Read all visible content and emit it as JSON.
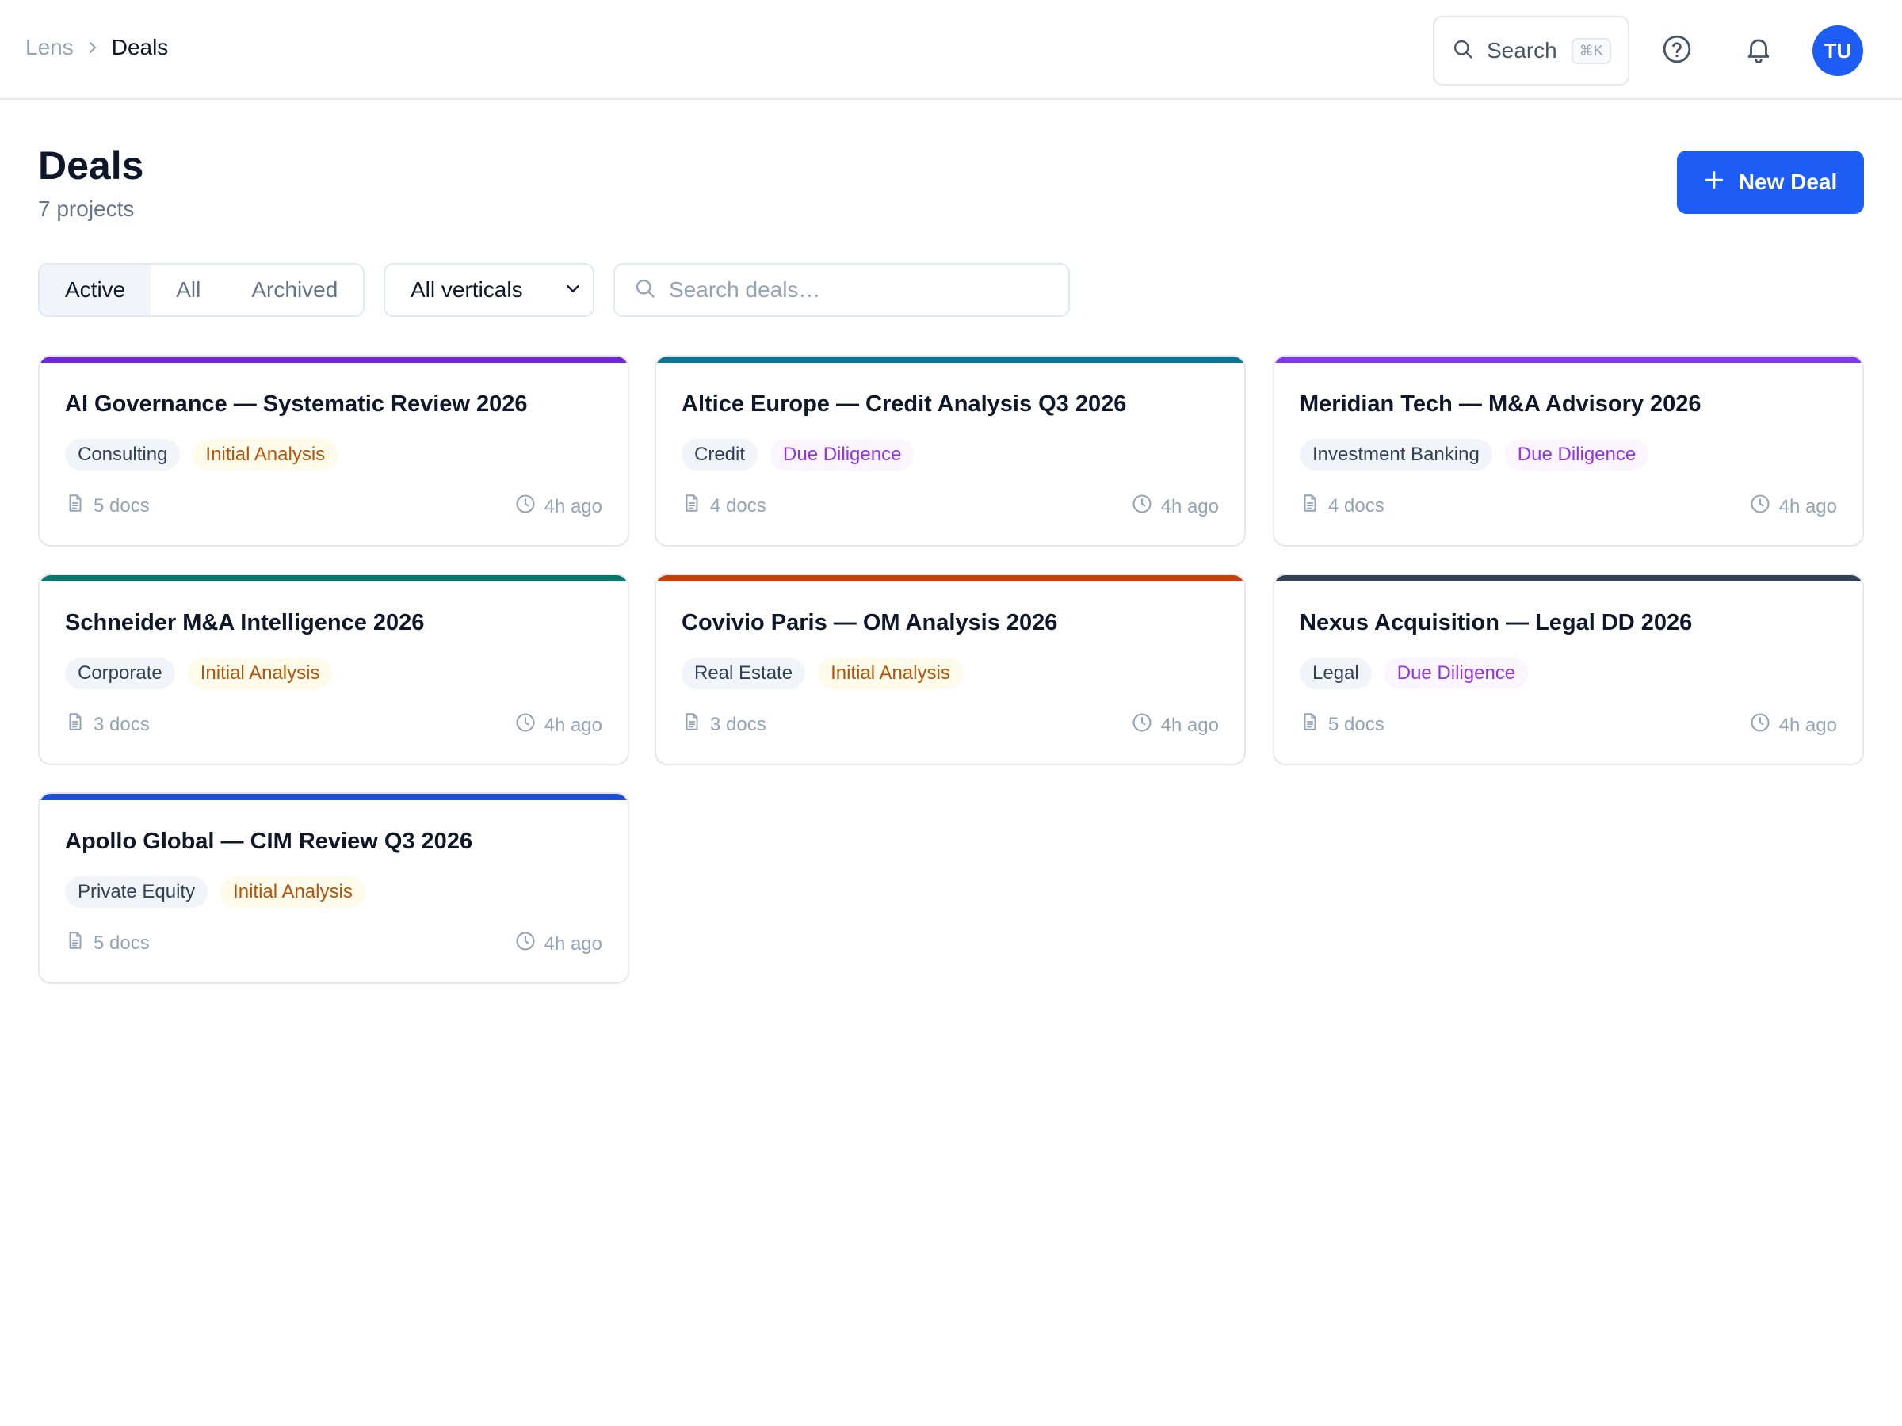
{
  "breadcrumb": {
    "root": "Lens",
    "current": "Deals"
  },
  "header": {
    "search_label": "Search",
    "search_shortcut": "⌘K",
    "avatar_initials": "TU"
  },
  "page": {
    "title": "Deals",
    "subtitle": "7 projects",
    "new_button": "New Deal"
  },
  "filters": {
    "tabs": [
      "Active",
      "All",
      "Archived"
    ],
    "active_tab": "Active",
    "vertical_select": "All verticals",
    "search_placeholder": "Search deals…"
  },
  "colors": {
    "accent": "#1d5cf5"
  },
  "deals": [
    {
      "title": "AI Governance — Systematic Review 2026",
      "vertical": "Consulting",
      "stage": "Initial Analysis",
      "docs": "5 docs",
      "updated": "4h ago",
      "accent": "#6d28d9"
    },
    {
      "title": "Altice Europe — Credit Analysis Q3 2026",
      "vertical": "Credit",
      "stage": "Due Diligence",
      "docs": "4 docs",
      "updated": "4h ago",
      "accent": "#0e7490"
    },
    {
      "title": "Meridian Tech — M&A Advisory 2026",
      "vertical": "Investment Banking",
      "stage": "Due Diligence",
      "docs": "4 docs",
      "updated": "4h ago",
      "accent": "#7c3aed"
    },
    {
      "title": "Schneider M&A Intelligence 2026",
      "vertical": "Corporate",
      "stage": "Initial Analysis",
      "docs": "3 docs",
      "updated": "4h ago",
      "accent": "#0f766e"
    },
    {
      "title": "Covivio Paris — OM Analysis 2026",
      "vertical": "Real Estate",
      "stage": "Initial Analysis",
      "docs": "3 docs",
      "updated": "4h ago",
      "accent": "#c2410c"
    },
    {
      "title": "Nexus Acquisition — Legal DD 2026",
      "vertical": "Legal",
      "stage": "Due Diligence",
      "docs": "5 docs",
      "updated": "4h ago",
      "accent": "#334155"
    },
    {
      "title": "Apollo Global — CIM Review Q3 2026",
      "vertical": "Private Equity",
      "stage": "Initial Analysis",
      "docs": "5 docs",
      "updated": "4h ago",
      "accent": "#1d4ed8"
    }
  ]
}
